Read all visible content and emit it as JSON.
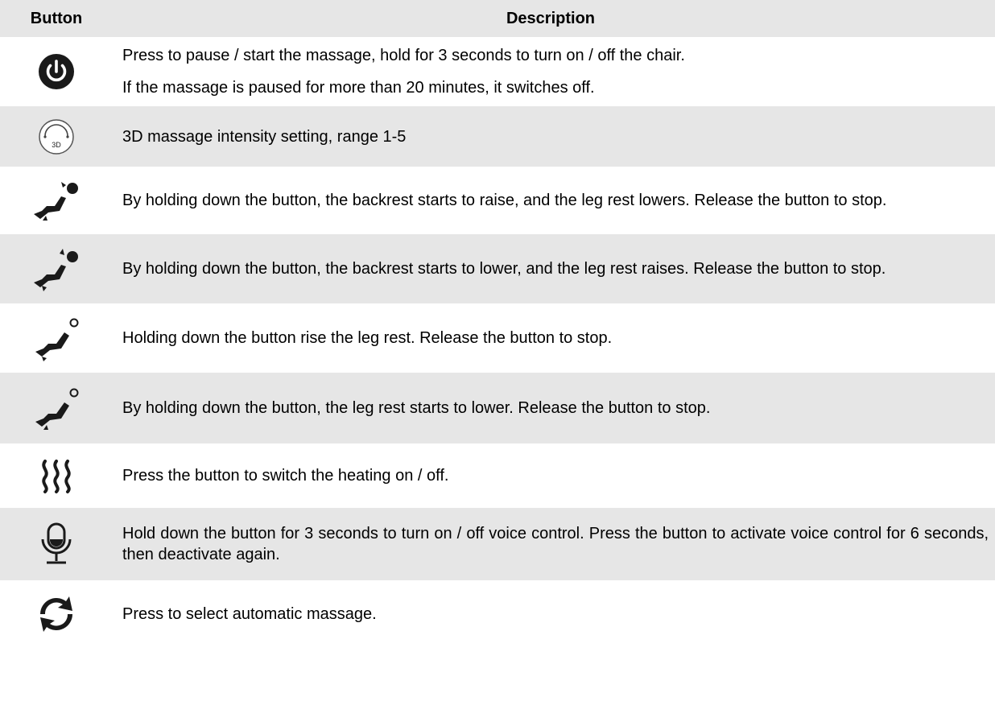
{
  "header": {
    "button": "Button",
    "description": "Description"
  },
  "rows": [
    {
      "icon": "power-icon",
      "lines": [
        "Press to pause / start the massage, hold for 3 seconds to turn on / off the chair.",
        "If the massage is paused for more than 20 minutes, it switches off."
      ]
    },
    {
      "icon": "3d-intensity-icon",
      "icon_label": "3D",
      "lines": [
        "3D massage intensity setting, range 1-5"
      ]
    },
    {
      "icon": "recline-backrest-up-icon",
      "lines": [
        "By holding down the button, the backrest starts to raise, and the leg rest lowers. Release the button to stop."
      ]
    },
    {
      "icon": "recline-backrest-down-icon",
      "lines": [
        "By holding down the button, the backrest starts to lower, and the leg rest raises. Release the button to stop."
      ]
    },
    {
      "icon": "legrest-up-icon",
      "lines": [
        "Holding down the button rise the leg rest. Release the button to stop."
      ]
    },
    {
      "icon": "legrest-down-icon",
      "lines": [
        "By holding down the button, the leg rest starts to lower. Release the button to stop."
      ]
    },
    {
      "icon": "heating-icon",
      "lines": [
        "Press the button to switch the heating on / off."
      ]
    },
    {
      "icon": "microphone-icon",
      "lines": [
        "Hold down the button for 3 seconds to turn on / off voice control. Press the button to activate voice control for 6 seconds, then deactivate again."
      ]
    },
    {
      "icon": "auto-massage-icon",
      "lines": [
        "Press to select automatic massage."
      ]
    }
  ],
  "colors": {
    "shade": "#e6e6e6",
    "icon": "#1a1a1a"
  }
}
